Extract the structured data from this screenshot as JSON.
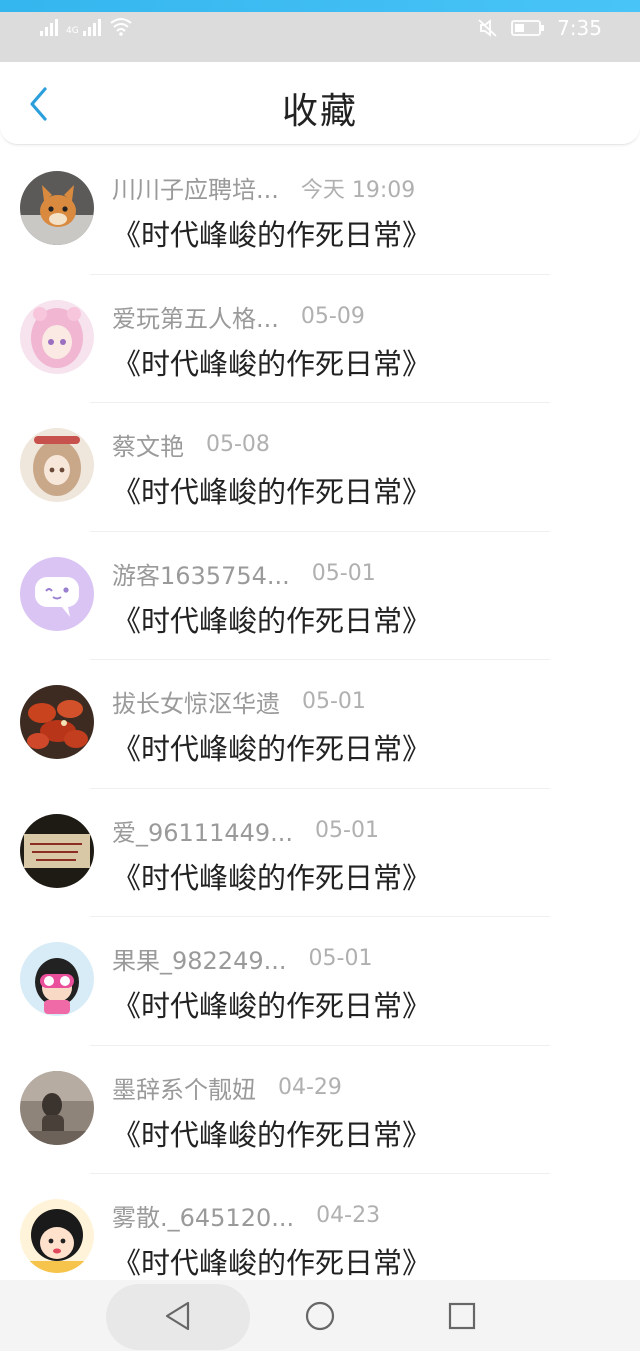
{
  "status_bar": {
    "network_label": "4G",
    "time": "7:35",
    "icons": [
      "signal-icon",
      "signal-4g-icon",
      "wifi-icon",
      "mute-icon",
      "battery-icon"
    ]
  },
  "header": {
    "title": "收藏",
    "back_icon": "chevron-left-icon",
    "accent_color": "#2a9fdb"
  },
  "favorites": [
    {
      "user": "川川子应聘培...",
      "date": "今天 19:09",
      "title": "《时代峰峻的作死日常》",
      "avatar": "cat-avatar"
    },
    {
      "user": "爱玩第五人格...",
      "date": "05-09",
      "title": "《时代峰峻的作死日常》",
      "avatar": "anime-pink-avatar"
    },
    {
      "user": "蔡文艳",
      "date": "05-08",
      "title": "《时代峰峻的作死日常》",
      "avatar": "anime-girl-avatar"
    },
    {
      "user": "游客1635754...",
      "date": "05-01",
      "title": "《时代峰峻的作死日常》",
      "avatar": "chat-bubble-avatar"
    },
    {
      "user": "拔长女惊沤华遗",
      "date": "05-01",
      "title": "《时代峰峻的作死日常》",
      "avatar": "crayfish-avatar"
    },
    {
      "user": "爱_96111449...",
      "date": "05-01",
      "title": "《时代峰峻的作死日常》",
      "avatar": "dark-text-avatar"
    },
    {
      "user": "果果_982249...",
      "date": "05-01",
      "title": "《时代峰峻的作死日常》",
      "avatar": "cartoon-girl-avatar"
    },
    {
      "user": "墨辞系个靓妞",
      "date": "04-29",
      "title": "《时代峰峻的作死日常》",
      "avatar": "photo-avatar"
    },
    {
      "user": "雾散._645120...",
      "date": "04-23",
      "title": "《时代峰峻的作死日常》",
      "avatar": "cartoon-face-avatar"
    }
  ],
  "bottom_nav": {
    "back": "triangle-back-icon",
    "home": "circle-home-icon",
    "recents": "square-recents-icon"
  }
}
